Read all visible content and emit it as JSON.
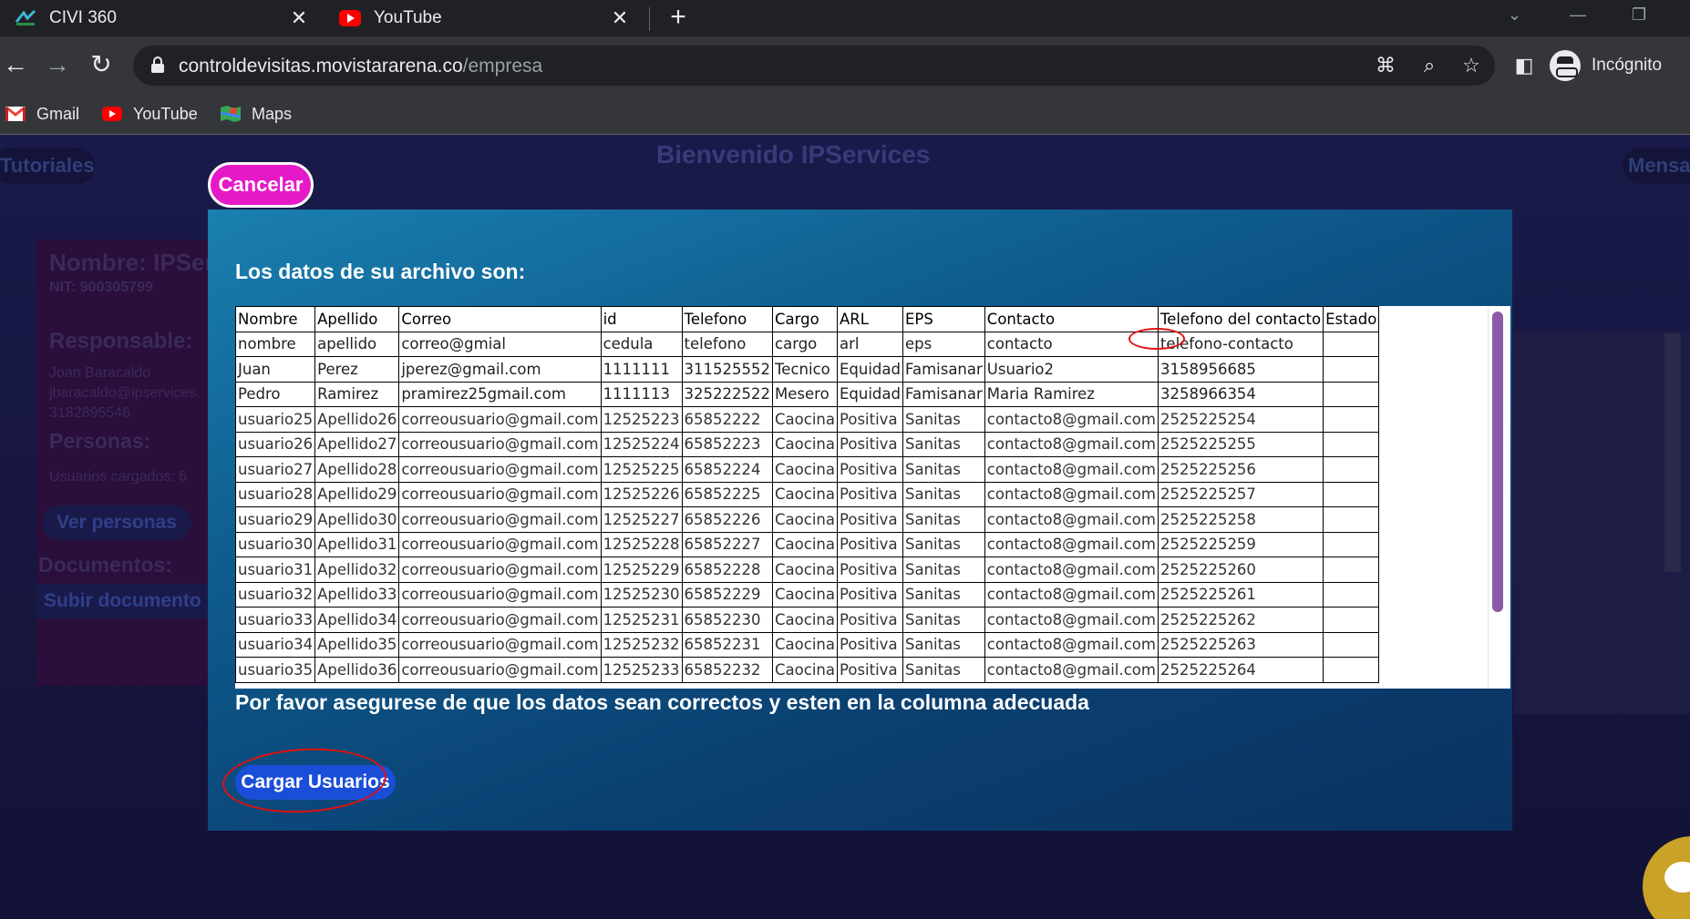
{
  "browser": {
    "tabs": [
      {
        "title": "CIVI 360",
        "icon": "civi-icon"
      },
      {
        "title": "YouTube",
        "icon": "youtube-icon"
      }
    ],
    "url_domain": "controldevisitas.movistararena.co",
    "url_path": "/empresa",
    "profile_label": "Incógnito",
    "bookmarks": [
      {
        "label": "Gmail",
        "icon": "gmail-icon"
      },
      {
        "label": "YouTube",
        "icon": "youtube-icon"
      },
      {
        "label": "Maps",
        "icon": "maps-icon"
      }
    ]
  },
  "background": {
    "welcome": "Bienvenido IPServices",
    "tutoriales": "Tutoriales",
    "mensajes": "Mensa",
    "profile": {
      "name": "Nombre: IPSer",
      "nit": "NIT: 900305799",
      "responsable_label": "Responsable:",
      "responsable_name": "Joan Baracaldo",
      "responsable_email": "jbaracaldo@ipservices.",
      "responsable_phone": "3182895546",
      "personas_label": "Personas:",
      "usuarios_cargados": "Usuarios cargados: 6",
      "ver_personas": "Ver personas",
      "documentos_label": "Documentos:",
      "subir_documento": "Subir documento"
    }
  },
  "modal": {
    "cancel_label": "Cancelar",
    "title": "Los datos de su archivo son:",
    "headers": [
      "Nombre",
      "Apellido",
      "Correo",
      "id",
      "Telefono",
      "Cargo",
      "ARL",
      "EPS",
      "Contacto",
      "Telefono del contacto",
      "Estado"
    ],
    "rows": [
      [
        "nombre",
        "apellido",
        "correo@gmial",
        "cedula",
        "telefono",
        "cargo",
        "arl",
        "eps",
        "contacto",
        "telefono-contacto",
        ""
      ],
      [
        "Juan",
        "Perez",
        "jperez@gmail.com",
        "1111111",
        "311525552",
        "Tecnico",
        "Equidad",
        "Famisanar",
        "Usuario2",
        "3158956685",
        ""
      ],
      [
        "Pedro",
        "Ramirez",
        "pramirez25gmail.com",
        "1111113",
        "325222522",
        "Mesero",
        "Equidad",
        "Famisanar",
        "Maria Ramirez",
        "3258966354",
        ""
      ],
      [
        "usuario25",
        "Apellido26",
        "correousuario@gmail.com",
        "12525223",
        "65852222",
        "Caocina",
        "Positiva",
        "Sanitas",
        "contacto8@gmail.com",
        "2525225254",
        ""
      ],
      [
        "usuario26",
        "Apellido27",
        "correousuario@gmail.com",
        "12525224",
        "65852223",
        "Caocina",
        "Positiva",
        "Sanitas",
        "contacto8@gmail.com",
        "2525225255",
        ""
      ],
      [
        "usuario27",
        "Apellido28",
        "correousuario@gmail.com",
        "12525225",
        "65852224",
        "Caocina",
        "Positiva",
        "Sanitas",
        "contacto8@gmail.com",
        "2525225256",
        ""
      ],
      [
        "usuario28",
        "Apellido29",
        "correousuario@gmail.com",
        "12525226",
        "65852225",
        "Caocina",
        "Positiva",
        "Sanitas",
        "contacto8@gmail.com",
        "2525225257",
        ""
      ],
      [
        "usuario29",
        "Apellido30",
        "correousuario@gmail.com",
        "12525227",
        "65852226",
        "Caocina",
        "Positiva",
        "Sanitas",
        "contacto8@gmail.com",
        "2525225258",
        ""
      ],
      [
        "usuario30",
        "Apellido31",
        "correousuario@gmail.com",
        "12525228",
        "65852227",
        "Caocina",
        "Positiva",
        "Sanitas",
        "contacto8@gmail.com",
        "2525225259",
        ""
      ],
      [
        "usuario31",
        "Apellido32",
        "correousuario@gmail.com",
        "12525229",
        "65852228",
        "Caocina",
        "Positiva",
        "Sanitas",
        "contacto8@gmail.com",
        "2525225260",
        ""
      ],
      [
        "usuario32",
        "Apellido33",
        "correousuario@gmail.com",
        "12525230",
        "65852229",
        "Caocina",
        "Positiva",
        "Sanitas",
        "contacto8@gmail.com",
        "2525225261",
        ""
      ],
      [
        "usuario33",
        "Apellido34",
        "correousuario@gmail.com",
        "12525231",
        "65852230",
        "Caocina",
        "Positiva",
        "Sanitas",
        "contacto8@gmail.com",
        "2525225262",
        ""
      ],
      [
        "usuario34",
        "Apellido35",
        "correousuario@gmail.com",
        "12525232",
        "65852231",
        "Caocina",
        "Positiva",
        "Sanitas",
        "contacto8@gmail.com",
        "2525225263",
        ""
      ],
      [
        "usuario35",
        "Apellido36",
        "correousuario@gmail.com",
        "12525233",
        "65852232",
        "Caocina",
        "Positiva",
        "Sanitas",
        "contacto8@gmail.com",
        "2525225264",
        ""
      ]
    ],
    "notice": "Por favor asegurese de que los datos sean correctos y esten en la columna adecuada",
    "upload_label": "Cargar Usuarios"
  },
  "colors": {
    "cancel_button": "#e619c8",
    "upload_button": "#1a4ed8",
    "annotation": "#e01010",
    "scrollbar_thumb": "#8a5aa8"
  }
}
